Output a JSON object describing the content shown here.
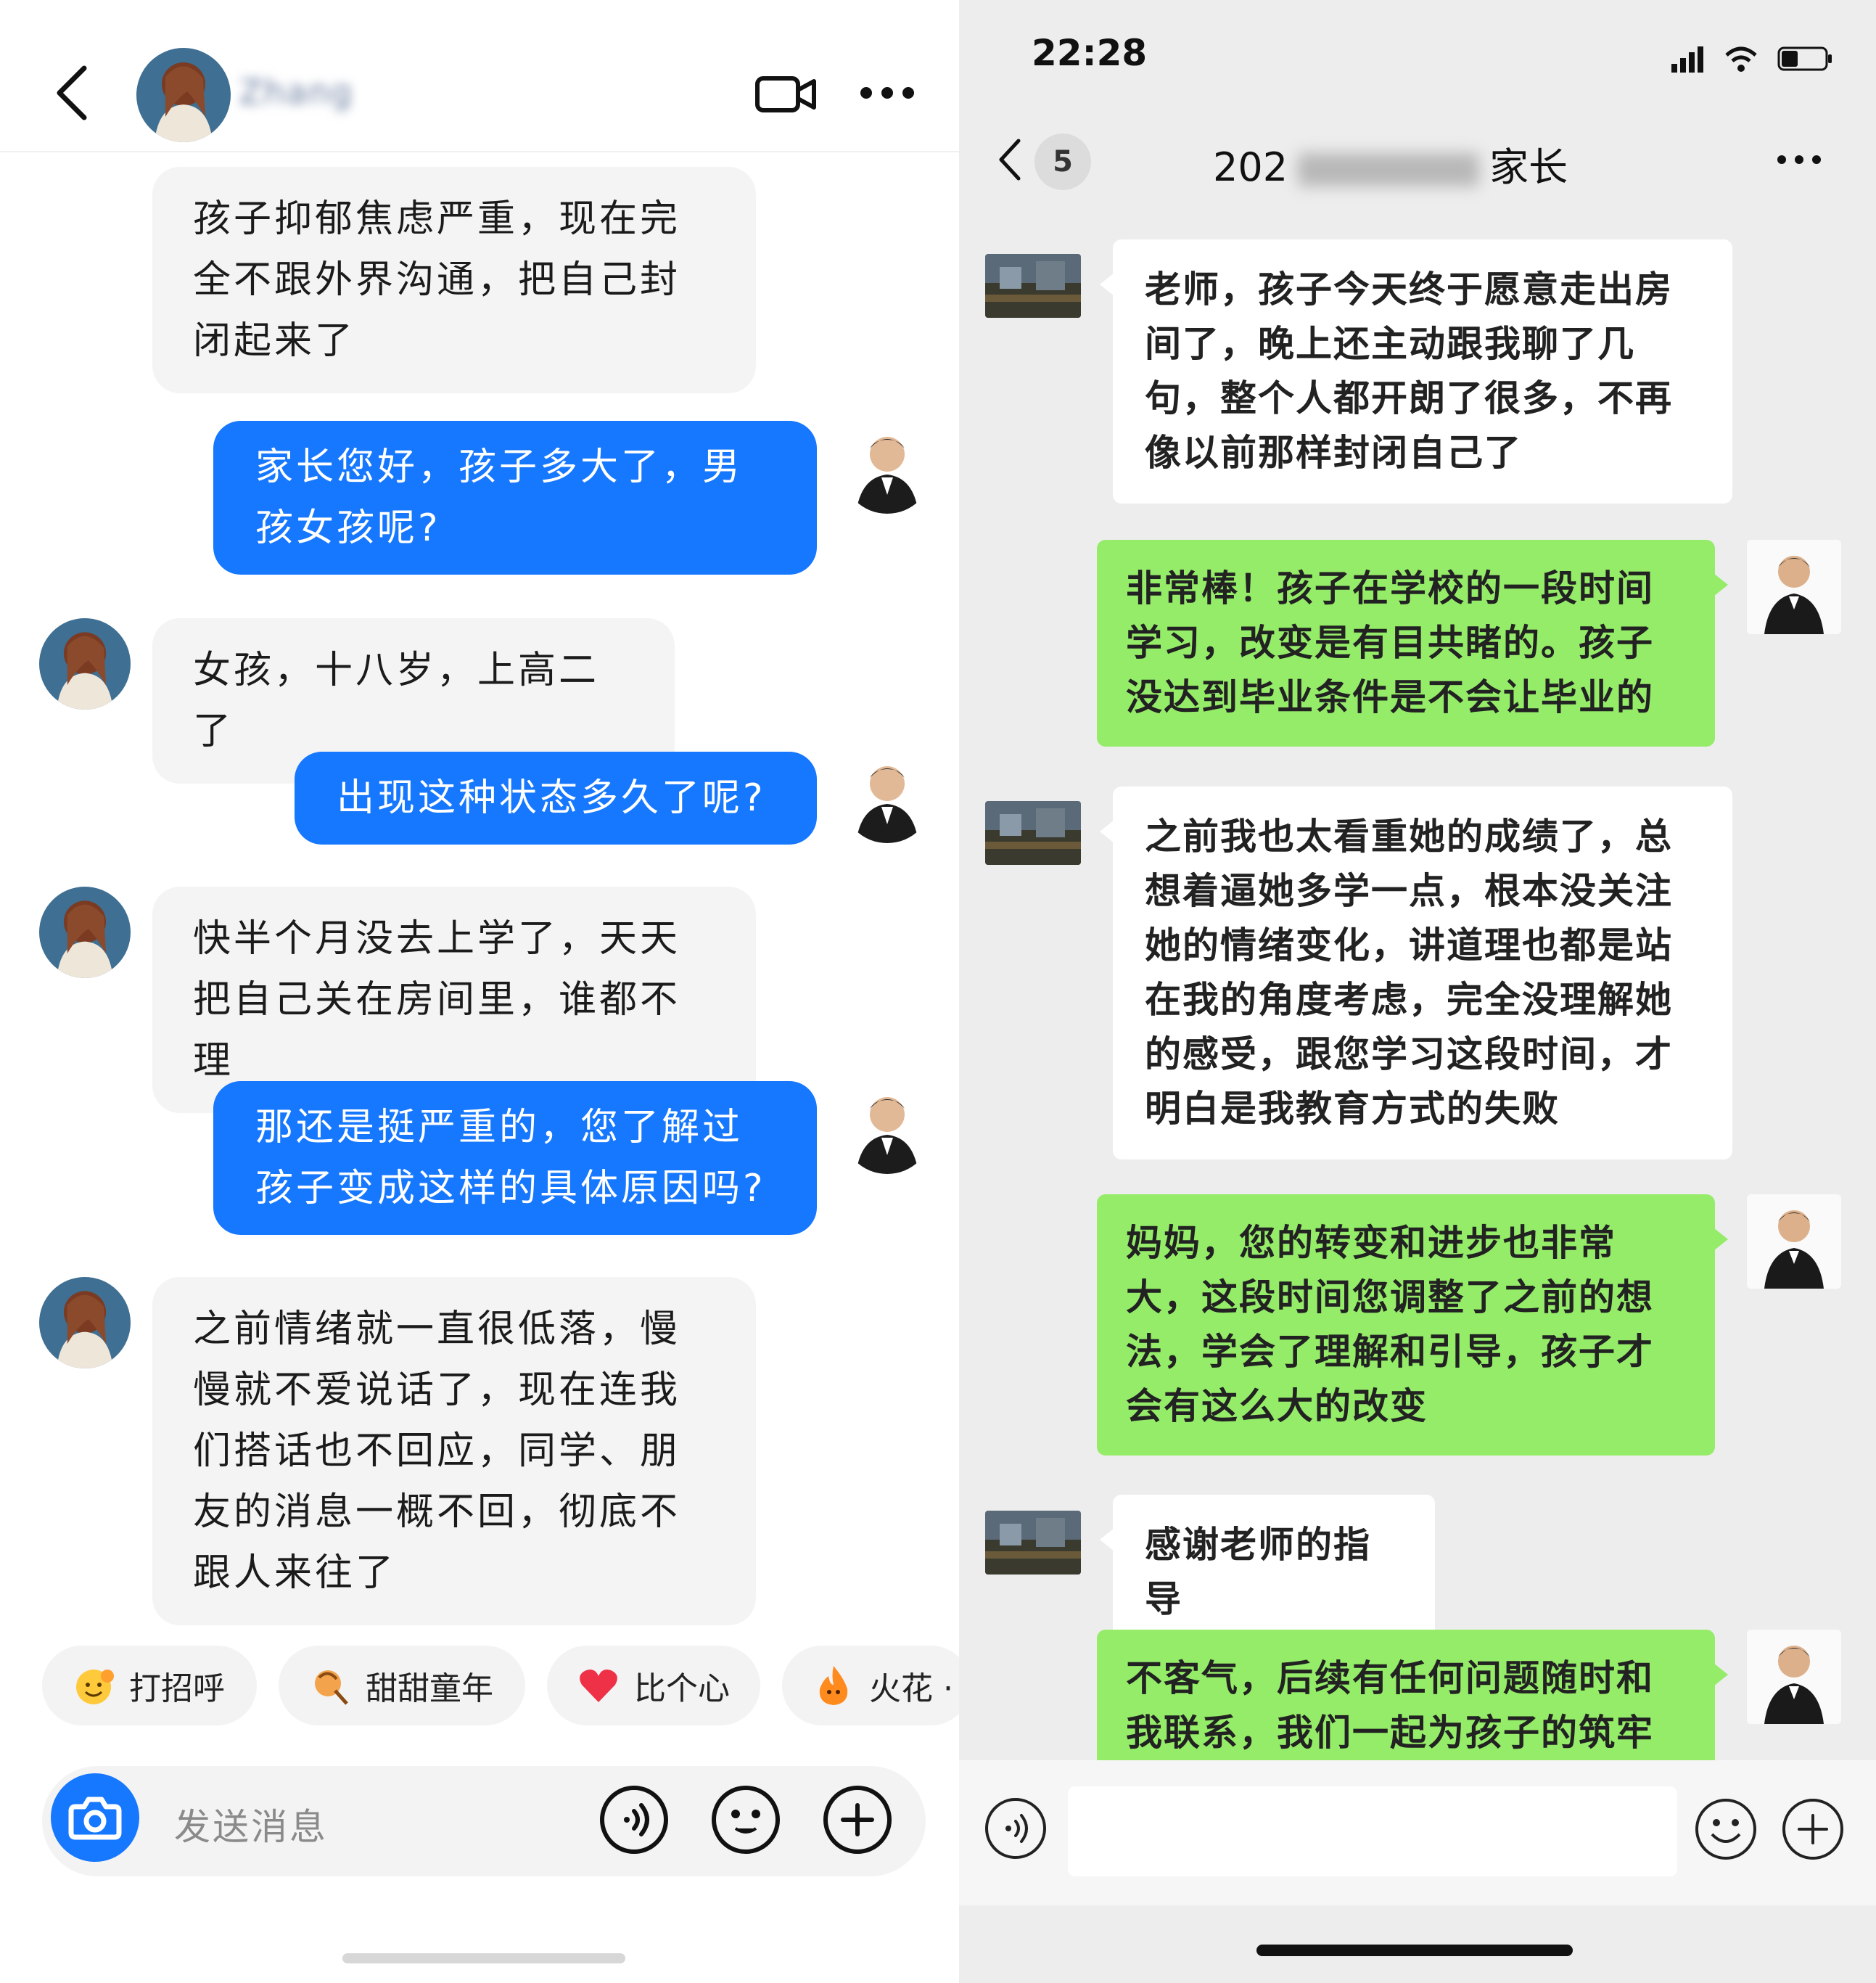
{
  "left": {
    "header": {
      "contact_name": "Zhang"
    },
    "messages": [
      {
        "side": "other",
        "text": "孩子抑郁焦虑严重，现在完全不跟外界沟通，把自己封闭起来了"
      },
      {
        "side": "me",
        "text": "家长您好，孩子多大了，男孩女孩呢?"
      },
      {
        "side": "other",
        "text": "女孩，十八岁，上高二了"
      },
      {
        "side": "me",
        "text": "出现这种状态多久了呢?"
      },
      {
        "side": "other",
        "text": "快半个月没去上学了，天天把自己关在房间里，谁都不理"
      },
      {
        "side": "me",
        "text": "那还是挺严重的，您了解过孩子变成这样的具体原因吗?"
      },
      {
        "side": "other",
        "text": "之前情绪就一直很低落，慢慢就不爱说话了，现在连我们搭话也不回应，同学、朋友的消息一概不回，彻底不跟人来往了"
      }
    ],
    "quick_replies": [
      {
        "label": "打招呼",
        "icon": "wave-emoji-icon"
      },
      {
        "label": "甜甜童年",
        "icon": "lollipop-emoji-icon"
      },
      {
        "label": "比个心",
        "icon": "heart-emoji-icon"
      },
      {
        "label": "火花 ·",
        "icon": "flame-emoji-icon"
      }
    ],
    "input": {
      "placeholder": "发送消息"
    },
    "colors": {
      "accent": "#1677ff",
      "bubble_other": "#f4f4f4"
    }
  },
  "right": {
    "status": {
      "time": "22:28"
    },
    "header": {
      "unread_badge": "5",
      "title_prefix": "202",
      "title_suffix": "家长"
    },
    "messages": [
      {
        "side": "other",
        "text": "老师，孩子今天终于愿意走出房间了，晚上还主动跟我聊了几句，整个人都开朗了很多，不再像以前那样封闭自己了"
      },
      {
        "side": "me",
        "text": "非常棒！孩子在学校的一段时间学习，改变是有目共睹的。孩子没达到毕业条件是不会让毕业的"
      },
      {
        "side": "other",
        "text": "之前我也太看重她的成绩了，总想着逼她多学一点，根本没关注她的情绪变化，讲道理也都是站在我的角度考虑，完全没理解她的感受，跟您学习这段时间，才明白是我教育方式的失败"
      },
      {
        "side": "me",
        "text": "妈妈，您的转变和进步也非常大，这段时间您调整了之前的想法，学会了理解和引导，孩子才会有这么大的改变"
      },
      {
        "side": "other",
        "text": "感谢老师的指导"
      },
      {
        "side": "me",
        "text": "不客气，后续有任何问题随时和我联系，我们一起为孩子的筑牢心理"
      }
    ],
    "colors": {
      "bubble_me": "#95ec69",
      "bubble_other": "#ffffff",
      "background": "#ededed"
    }
  }
}
